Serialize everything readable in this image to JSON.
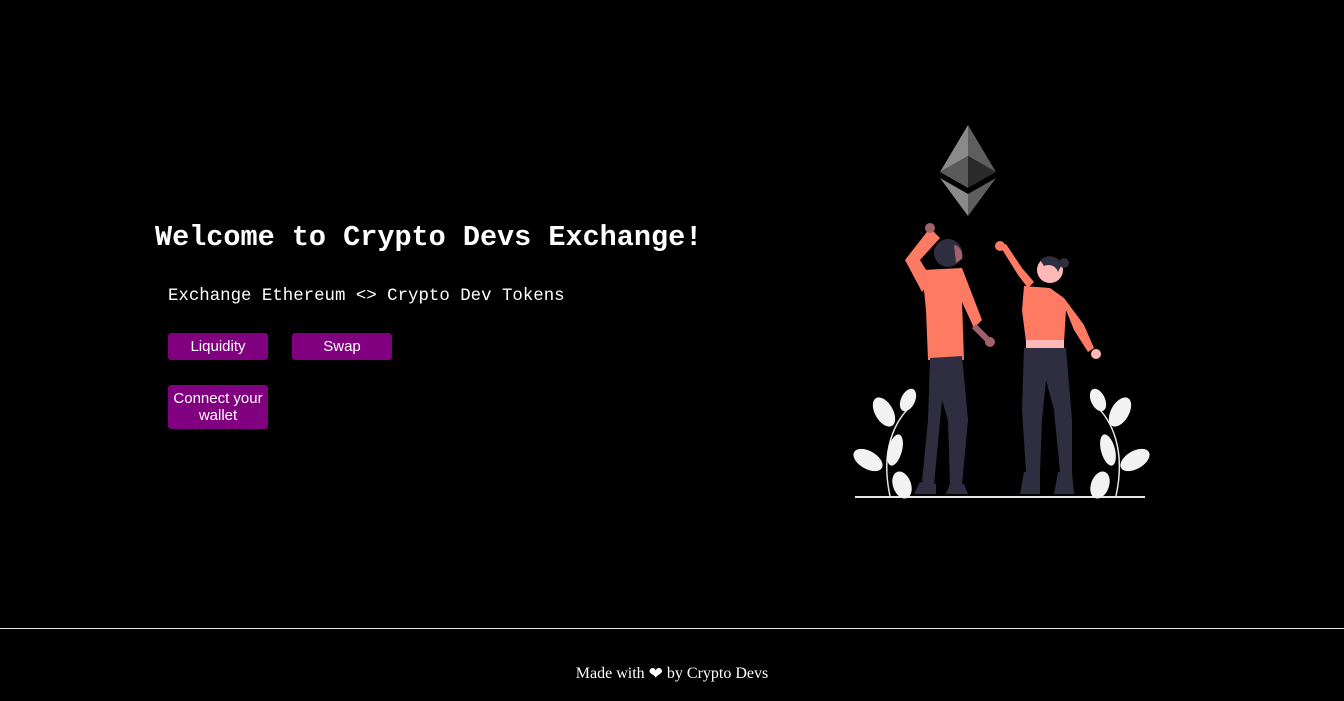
{
  "hero": {
    "title": "Welcome to Crypto Devs Exchange!",
    "description": "Exchange Ethereum <> Crypto Dev Tokens"
  },
  "buttons": {
    "liquidity_label": "Liquidity",
    "swap_label": "Swap",
    "connect_label": "Connect your wallet"
  },
  "illustration": {
    "icon": "ethereum-logo-icon",
    "description_icons": [
      "celebrating-people-icon",
      "plant-icon"
    ]
  },
  "footer": {
    "prefix": "Made with",
    "heart_icon": "heart-icon",
    "suffix": "by Crypto Devs"
  },
  "colors": {
    "background": "#000000",
    "button": "#800080",
    "accent": "#ff7a62",
    "dark": "#2f2e41"
  }
}
